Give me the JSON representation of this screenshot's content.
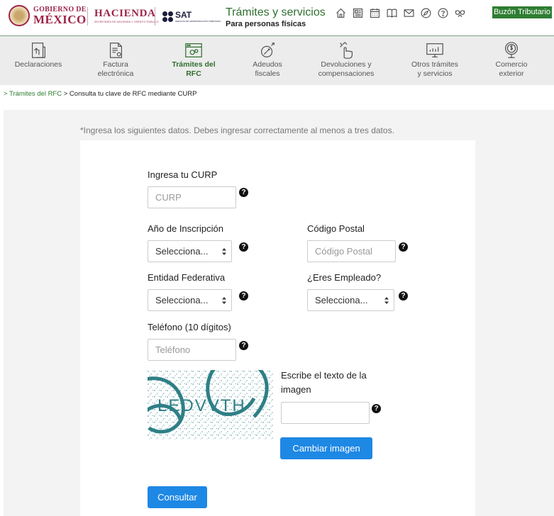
{
  "header": {
    "gob_line1": "GOBIERNO DE",
    "gob_line2": "MÉXICO",
    "hacienda_line1": "HACIENDA",
    "hacienda_line2": "SECRETARÍA DE HACIENDA Y CRÉDITO PÚBLICO",
    "sat_line1": "SAT",
    "sat_line2": "SERVICIO DE ADMINISTRACIÓN TRIBUTARIA",
    "title": "Trámites y servicios",
    "subtitle": "Para personas físicas",
    "icons": [
      "home-icon",
      "newspaper-icon",
      "calendar-icon",
      "book-icon",
      "mail-icon",
      "compass-icon",
      "help-icon",
      "accessibility-icon"
    ],
    "buzon_label": "Buzón Tributario"
  },
  "nav": {
    "items": [
      {
        "label": "Declaraciones",
        "icon": "declaraciones-icon"
      },
      {
        "label": "Factura\nelectrónica",
        "icon": "factura-icon"
      },
      {
        "label": "Trámites del\nRFC",
        "icon": "rfc-icon",
        "active": true
      },
      {
        "label": "Adeudos\nfiscales",
        "icon": "adeudos-icon"
      },
      {
        "label": "Devoluciones y\ncompensaciones",
        "icon": "devoluciones-icon"
      },
      {
        "label": "Otros trámites\ny servicios",
        "icon": "otros-icon"
      },
      {
        "label": "Comercio\nexterior",
        "icon": "comercio-icon"
      }
    ]
  },
  "breadcrumb": {
    "link": "> Trámites del RFC",
    "current": " > Consulta tu clave de RFC mediante CURP"
  },
  "form": {
    "instruction": "*Ingresa los siguientes datos. Debes ingresar correctamente al menos a tres datos.",
    "curp_label": "Ingresa tu CURP",
    "curp_placeholder": "CURP",
    "anio_label": "Año de Inscripción",
    "anio_value": "Selecciona...",
    "cp_label": "Código Postal",
    "cp_placeholder": "Código Postal",
    "entidad_label": "Entidad Federativa",
    "entidad_value": "Selecciona...",
    "empleado_label": "¿Eres Empleado?",
    "empleado_value": "Selecciona...",
    "telefono_label": "Teléfono (10 dígitos)",
    "telefono_placeholder": "Teléfono",
    "captcha_text": "LEDVVTH",
    "captcha_label": "Escribe el texto de la imagen",
    "captcha_input_value": "",
    "cambiar_label": "Cambiar imagen",
    "consultar_label": "Consultar",
    "help_glyph": "?"
  },
  "colors": {
    "brand": "#9d2449",
    "green": "#2e7d32",
    "button_blue": "#1e88e5"
  }
}
